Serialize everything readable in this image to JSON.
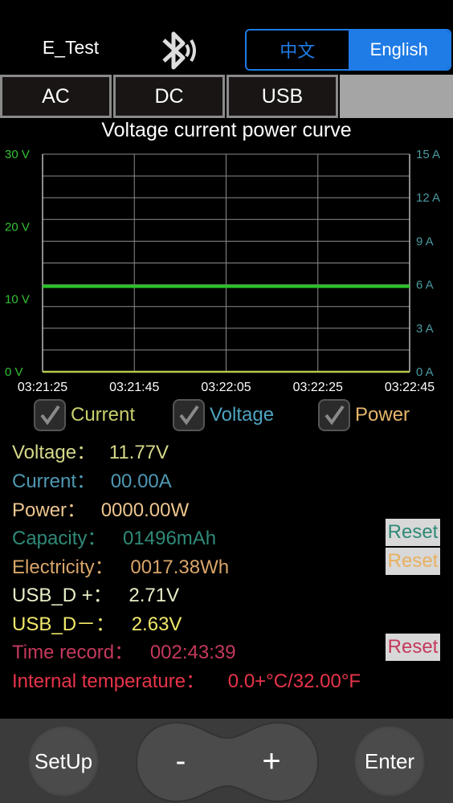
{
  "header": {
    "app_title": "E_Test",
    "bluetooth_icon": "bluetooth-icon",
    "lang_zh": "中文",
    "lang_en": "English",
    "active_lang": "English"
  },
  "tabs": [
    {
      "label": "AC"
    },
    {
      "label": "DC"
    },
    {
      "label": "USB"
    }
  ],
  "chart_data": {
    "type": "line",
    "title": "Voltage current power curve",
    "x_ticks": [
      "03:21:25",
      "03:21:45",
      "03:22:05",
      "03:22:25",
      "03:22:45"
    ],
    "y_left_ticks": [
      "0 V",
      "10 V",
      "20 V",
      "30 V"
    ],
    "y_left_range": [
      0,
      30
    ],
    "y_right_ticks": [
      "0 A",
      "3 A",
      "6 A",
      "9 A",
      "12 A",
      "15 A"
    ],
    "y_right_range": [
      0,
      15
    ],
    "grid": true,
    "series": [
      {
        "name": "Voltage",
        "axis": "left",
        "x": [
          "03:21:25",
          "03:22:45"
        ],
        "values": [
          11.77,
          11.77
        ],
        "color": "#27c227"
      },
      {
        "name": "Current",
        "axis": "right",
        "x": [
          "03:21:25",
          "03:22:45"
        ],
        "values": [
          0.0,
          0.0
        ],
        "color": "#b9c94a"
      }
    ],
    "colors": {
      "left_axis": "#35c235",
      "right_axis": "#4a9aa0",
      "grid": "#8c8c8c"
    }
  },
  "checkboxes": [
    {
      "label": "Current",
      "color": "#c9cf6a",
      "checked": true
    },
    {
      "label": "Voltage",
      "color": "#4da3bf",
      "checked": true
    },
    {
      "label": "Power",
      "color": "#e6b66a",
      "checked": true
    }
  ],
  "readings": {
    "voltage": {
      "label": "Voltage：",
      "value": "11.77V",
      "color": "#d6d88a"
    },
    "current": {
      "label": "Current：",
      "value": "00.00A",
      "color": "#4f98b2"
    },
    "power": {
      "label": "Power：",
      "value": "0000.00W",
      "color": "#ecc58f"
    },
    "capacity": {
      "label": "Capacity：",
      "value": "01496mAh",
      "color": "#2f8a78"
    },
    "electricity": {
      "label": "Electricity：",
      "value": "0017.38Wh",
      "color": "#d9a56a"
    },
    "usb_dplus": {
      "label": "USB_D +：",
      "value": "2.71V",
      "color": "#e6f0c8"
    },
    "usb_dminus": {
      "label": "USB_D－：",
      "value": "2.63V",
      "color": "#f2e86a"
    },
    "time_record": {
      "label": "Time record：",
      "value": "002:43:39",
      "color": "#c4395b"
    },
    "internal_temp": {
      "label": "Internal temperature：",
      "value": "0.0+°C/32.00°F",
      "color": "#e8344a"
    }
  },
  "reset_buttons": {
    "capacity": {
      "label": "Reset",
      "color": "#2f8a78"
    },
    "electricity": {
      "label": "Reset",
      "color": "#e8b060"
    },
    "time": {
      "label": "Reset",
      "color": "#c4395b"
    }
  },
  "controls": {
    "setup": "SetUp",
    "minus": "-",
    "plus": "+",
    "enter": "Enter"
  }
}
